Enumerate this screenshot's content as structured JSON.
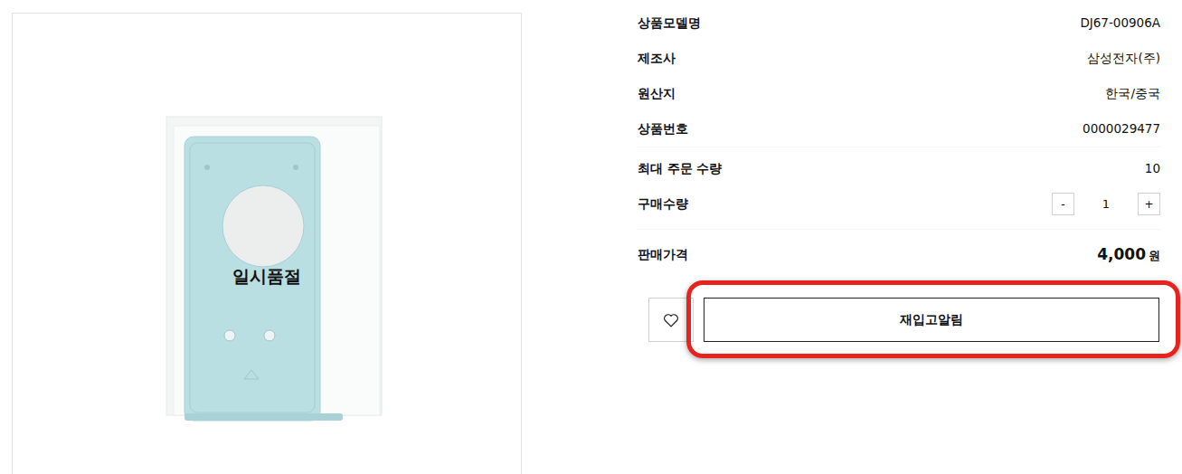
{
  "product_image": {
    "overlay": "일시품절"
  },
  "info": [
    {
      "label": "상품모델명",
      "value": "DJ67-00906A"
    },
    {
      "label": "제조사",
      "value": "삼성전자(주)"
    },
    {
      "label": "원산지",
      "value": "한국/중국"
    },
    {
      "label": "상품번호",
      "value": "0000029477"
    }
  ],
  "order": {
    "max": {
      "label": "최대 주문 수량",
      "value": "10"
    },
    "quantity": {
      "label": "구매수량",
      "minus": "-",
      "value": "1",
      "plus": "+"
    }
  },
  "price": {
    "label": "판매가격",
    "amount": "4,000",
    "unit": "원"
  },
  "restock_button": {
    "label": "재입고알림",
    "highlighted": true
  }
}
